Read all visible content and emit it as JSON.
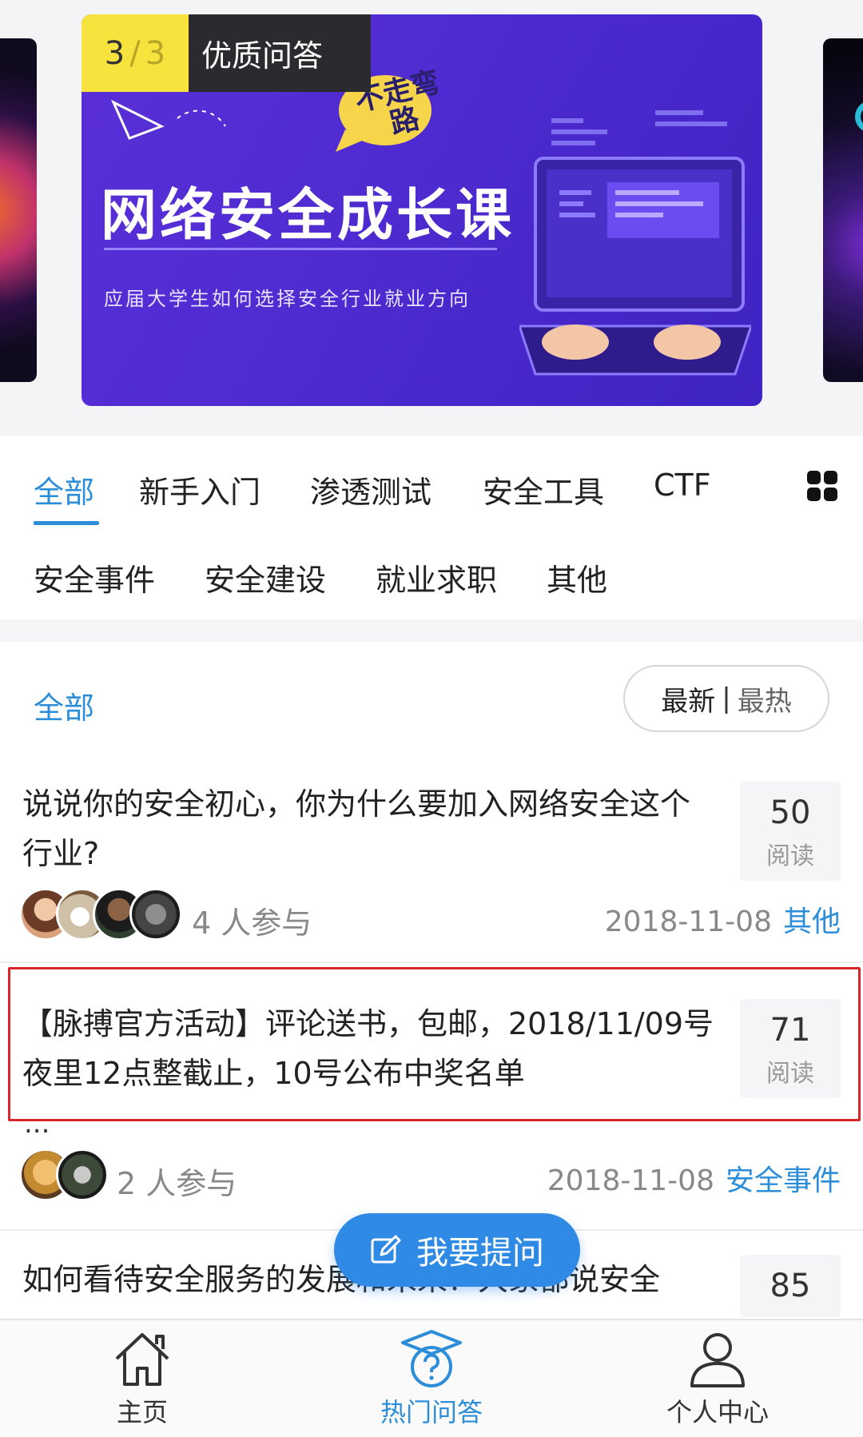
{
  "banner": {
    "counter_current": "3",
    "counter_sep": "/",
    "counter_total": "3",
    "tag": "优质问答",
    "bubble_text": "不走弯路",
    "headline": "网络安全成长课",
    "subtitle": "应届大学生如何选择安全行业就业方向"
  },
  "categories": {
    "row1": [
      "全部",
      "新手入门",
      "渗透测试",
      "安全工具",
      "CTF"
    ],
    "row2": [
      "安全事件",
      "安全建设",
      "就业求职",
      "其他"
    ],
    "active": "全部"
  },
  "filter": {
    "label": "全部",
    "sort_new": "最新",
    "sort_sep": "|",
    "sort_hot": "最热"
  },
  "posts": [
    {
      "title": "说说你的安全初心，你为什么要加入网络安全这个行业?",
      "reads": "50",
      "read_label": "阅读",
      "participants": "4 人参与",
      "date": "2018-11-08",
      "tag": "其他"
    },
    {
      "title": "【脉搏官方活动】评论送书，包邮，2018/11/09号夜里12点整截止，10号公布中奖名单",
      "ellipsis": "...",
      "reads": "71",
      "read_label": "阅读",
      "participants": "2 人参与",
      "date": "2018-11-08",
      "tag": "安全事件"
    },
    {
      "title": "如何看待安全服务的发展和未来？大家都说安全",
      "reads": "85"
    }
  ],
  "fab": {
    "label": "我要提问"
  },
  "nav": {
    "home": "主页",
    "qa": "热门问答",
    "profile": "个人中心",
    "active": "热门问答"
  },
  "colors": {
    "accent": "#2c8ed8",
    "highlight_border": "#d9262c",
    "banner_purple": "#4e2bd0",
    "counter_yellow": "#f7e23e"
  }
}
